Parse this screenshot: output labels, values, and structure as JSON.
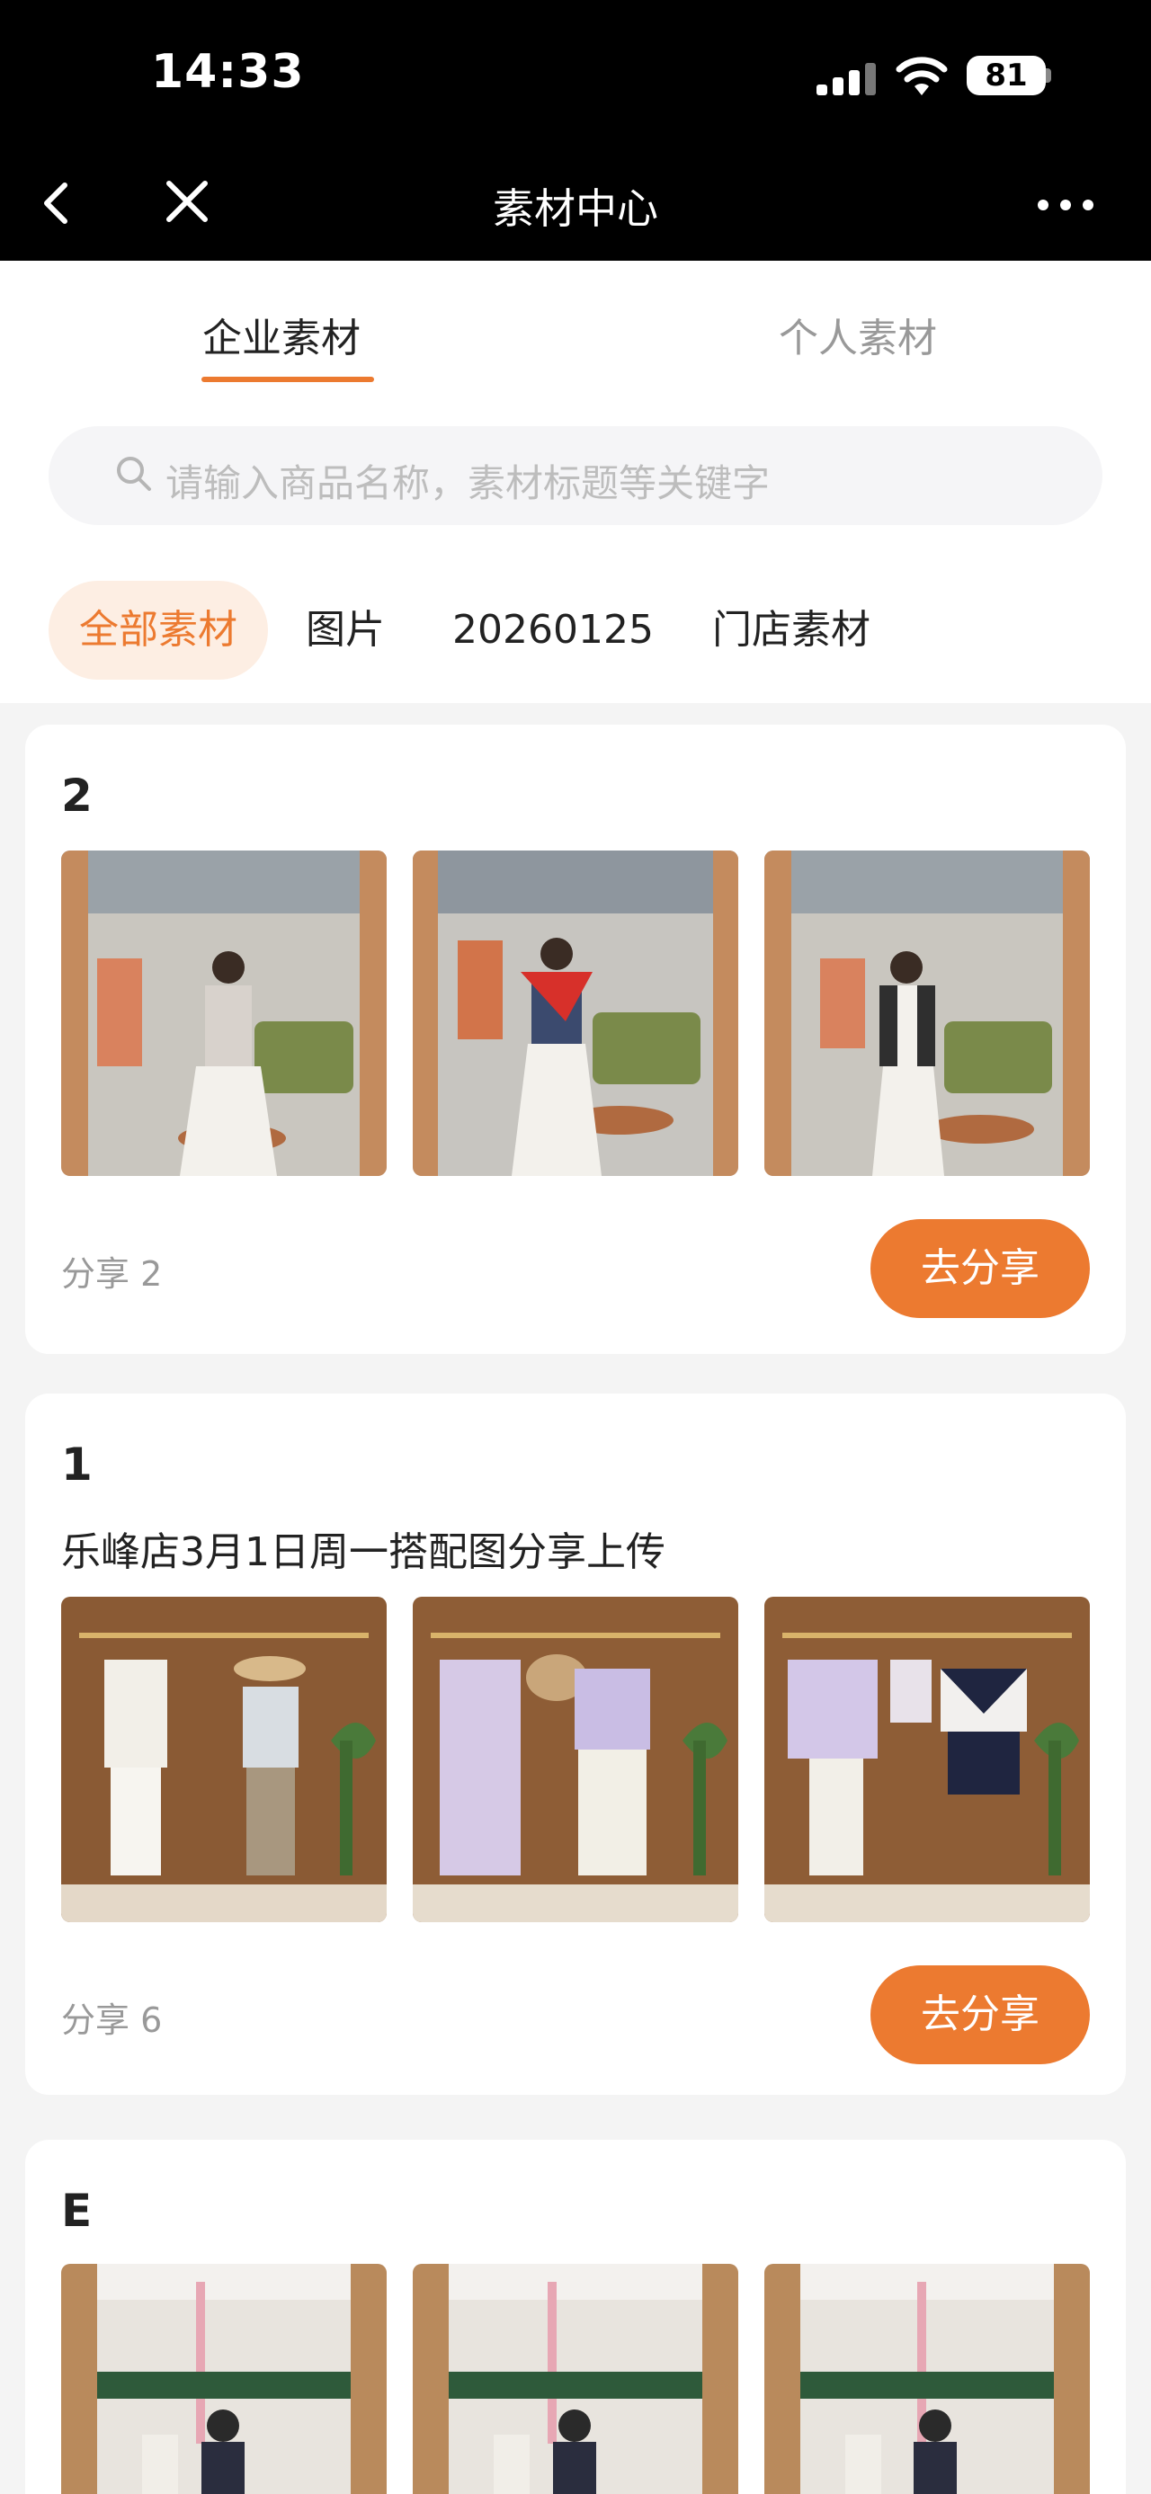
{
  "status_bar": {
    "time": "14:33",
    "battery": "81"
  },
  "nav": {
    "title": "素材中心"
  },
  "tabs": [
    {
      "label": "企业素材",
      "active": true
    },
    {
      "label": "个人素材",
      "active": false
    }
  ],
  "search": {
    "placeholder": "请输入商品名称，素材标题等关键字"
  },
  "filters": [
    "全部素材",
    "图片",
    "20260125",
    "门店素材"
  ],
  "cards": [
    {
      "title": "2",
      "description": "",
      "share_count": "分享 2",
      "share_button": "去分享"
    },
    {
      "title": "1",
      "description": "乐峰店3月1日周一搭配图分享上传",
      "share_count": "分享 6",
      "share_button": "去分享"
    },
    {
      "title": "E",
      "description": "",
      "share_count": "",
      "share_button": ""
    }
  ],
  "colors": {
    "accent": "#ec7a30",
    "accent_light": "#fdeee3",
    "nav_bg": "#000000"
  }
}
